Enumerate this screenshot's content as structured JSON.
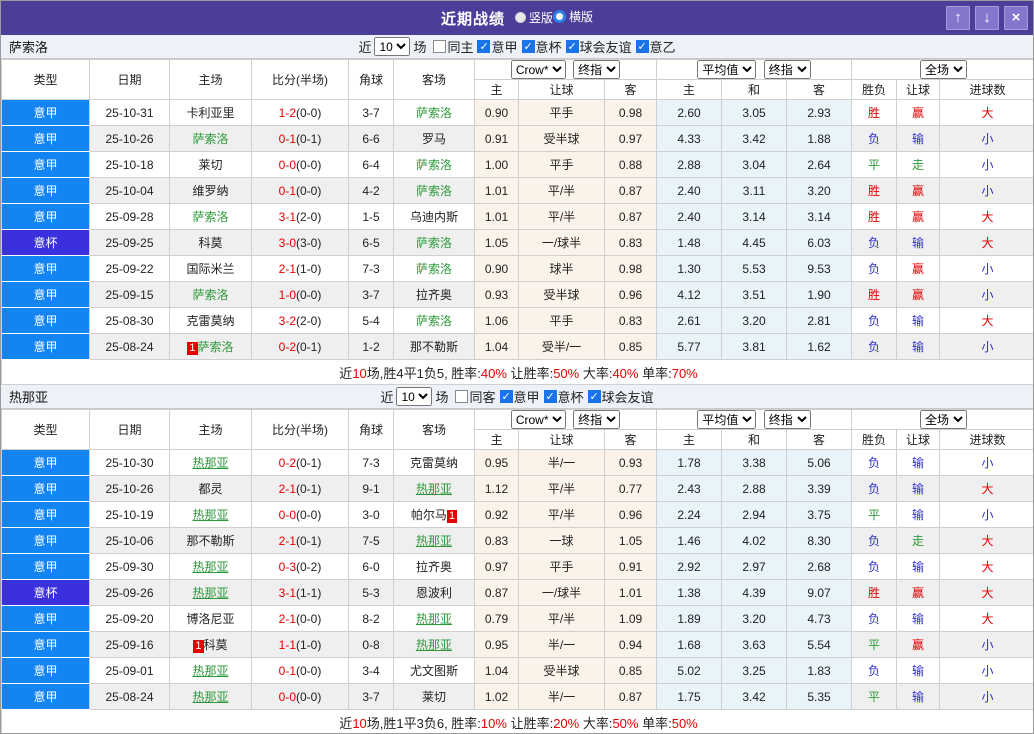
{
  "colors": {
    "titlebar_purple": "#4b3e99",
    "league_blue": "#1385f2",
    "cup_purple": "#3a30de",
    "focus_green": "#2c9a3a",
    "win_red": "#e60000",
    "loss_blue": "#2e2ed2",
    "draw_green": "#2c9a3a"
  },
  "titlebar": {
    "title": "近期战绩",
    "radios": [
      {
        "label": "竖版",
        "checked": false
      },
      {
        "label": "横版",
        "checked": true
      }
    ],
    "buttons": {
      "up": "↑",
      "down": "↓",
      "close": "×"
    }
  },
  "table_header": {
    "type": "类型",
    "date": "日期",
    "home": "主场",
    "score": "比分(半场)",
    "corner": "角球",
    "away": "客场",
    "odds_cols": [
      "主",
      "让球",
      "客"
    ],
    "avg_cols": [
      "主",
      "和",
      "客"
    ],
    "result_cols": [
      "胜负",
      "让球",
      "进球数"
    ]
  },
  "sections": [
    {
      "team": "萨索洛",
      "filter": {
        "near": "近",
        "count": "10",
        "games": "场",
        "same": {
          "label": "同主",
          "checked": false
        },
        "leagues": [
          {
            "label": "意甲",
            "checked": true
          },
          {
            "label": "意杯",
            "checked": true
          },
          {
            "label": "球会友谊",
            "checked": true
          },
          {
            "label": "意乙",
            "checked": true
          }
        ]
      },
      "selects": {
        "odds1": "Crow*",
        "odds2": "终指",
        "avg1": "平均值",
        "avg2": "终指",
        "scope": "全场"
      },
      "focus_underline": false,
      "rows": [
        {
          "type": "意甲",
          "cup": false,
          "date": "25-10-31",
          "home": {
            "name": "卡利亚里",
            "focus": false
          },
          "score_ft": "1-2",
          "score_ht": "(0-0)",
          "corner": "3-7",
          "away": {
            "name": "萨索洛",
            "focus": true
          },
          "odds": [
            "0.90",
            "平手",
            "0.98"
          ],
          "avg": [
            "2.60",
            "3.05",
            "2.93"
          ],
          "result": [
            [
              "胜",
              "r"
            ],
            [
              "赢",
              "r"
            ],
            [
              "大",
              "r"
            ]
          ]
        },
        {
          "type": "意甲",
          "cup": false,
          "date": "25-10-26",
          "home": {
            "name": "萨索洛",
            "focus": true
          },
          "score_ft": "0-1",
          "score_ht": "(0-1)",
          "corner": "6-6",
          "away": {
            "name": "罗马",
            "focus": false
          },
          "odds": [
            "0.91",
            "受半球",
            "0.97"
          ],
          "avg": [
            "4.33",
            "3.42",
            "1.88"
          ],
          "result": [
            [
              "负",
              "b"
            ],
            [
              "输",
              "b"
            ],
            [
              "小",
              "b"
            ]
          ]
        },
        {
          "type": "意甲",
          "cup": false,
          "date": "25-10-18",
          "home": {
            "name": "莱切",
            "focus": false
          },
          "score_ft": "0-0",
          "score_ht": "(0-0)",
          "corner": "6-4",
          "away": {
            "name": "萨索洛",
            "focus": true
          },
          "odds": [
            "1.00",
            "平手",
            "0.88"
          ],
          "avg": [
            "2.88",
            "3.04",
            "2.64"
          ],
          "result": [
            [
              "平",
              "g"
            ],
            [
              "走",
              "g"
            ],
            [
              "小",
              "b"
            ]
          ]
        },
        {
          "type": "意甲",
          "cup": false,
          "date": "25-10-04",
          "home": {
            "name": "维罗纳",
            "focus": false
          },
          "score_ft": "0-1",
          "score_ht": "(0-0)",
          "corner": "4-2",
          "away": {
            "name": "萨索洛",
            "focus": true
          },
          "odds": [
            "1.01",
            "平/半",
            "0.87"
          ],
          "avg": [
            "2.40",
            "3.11",
            "3.20"
          ],
          "result": [
            [
              "胜",
              "r"
            ],
            [
              "赢",
              "r"
            ],
            [
              "小",
              "b"
            ]
          ]
        },
        {
          "type": "意甲",
          "cup": false,
          "date": "25-09-28",
          "home": {
            "name": "萨索洛",
            "focus": true
          },
          "score_ft": "3-1",
          "score_ht": "(2-0)",
          "corner": "1-5",
          "away": {
            "name": "乌迪内斯",
            "focus": false
          },
          "odds": [
            "1.01",
            "平/半",
            "0.87"
          ],
          "avg": [
            "2.40",
            "3.14",
            "3.14"
          ],
          "result": [
            [
              "胜",
              "r"
            ],
            [
              "赢",
              "r"
            ],
            [
              "大",
              "r"
            ]
          ]
        },
        {
          "type": "意杯",
          "cup": true,
          "date": "25-09-25",
          "home": {
            "name": "科莫",
            "focus": false
          },
          "score_ft": "3-0",
          "score_ht": "(3-0)",
          "corner": "6-5",
          "away": {
            "name": "萨索洛",
            "focus": true
          },
          "odds": [
            "1.05",
            "一/球半",
            "0.83"
          ],
          "avg": [
            "1.48",
            "4.45",
            "6.03"
          ],
          "result": [
            [
              "负",
              "b"
            ],
            [
              "输",
              "b"
            ],
            [
              "大",
              "r"
            ]
          ]
        },
        {
          "type": "意甲",
          "cup": false,
          "date": "25-09-22",
          "home": {
            "name": "国际米兰",
            "focus": false
          },
          "score_ft": "2-1",
          "score_ht": "(1-0)",
          "corner": "7-3",
          "away": {
            "name": "萨索洛",
            "focus": true
          },
          "odds": [
            "0.90",
            "球半",
            "0.98"
          ],
          "avg": [
            "1.30",
            "5.53",
            "9.53"
          ],
          "result": [
            [
              "负",
              "b"
            ],
            [
              "赢",
              "r"
            ],
            [
              "小",
              "b"
            ]
          ]
        },
        {
          "type": "意甲",
          "cup": false,
          "date": "25-09-15",
          "home": {
            "name": "萨索洛",
            "focus": true
          },
          "score_ft": "1-0",
          "score_ht": "(0-0)",
          "corner": "3-7",
          "away": {
            "name": "拉齐奥",
            "focus": false
          },
          "odds": [
            "0.93",
            "受半球",
            "0.96"
          ],
          "avg": [
            "4.12",
            "3.51",
            "1.90"
          ],
          "result": [
            [
              "胜",
              "r"
            ],
            [
              "赢",
              "r"
            ],
            [
              "小",
              "b"
            ]
          ]
        },
        {
          "type": "意甲",
          "cup": false,
          "date": "25-08-30",
          "home": {
            "name": "克雷莫纳",
            "focus": false
          },
          "score_ft": "3-2",
          "score_ht": "(2-0)",
          "corner": "5-4",
          "away": {
            "name": "萨索洛",
            "focus": true
          },
          "odds": [
            "1.06",
            "平手",
            "0.83"
          ],
          "avg": [
            "2.61",
            "3.20",
            "2.81"
          ],
          "result": [
            [
              "负",
              "b"
            ],
            [
              "输",
              "b"
            ],
            [
              "大",
              "r"
            ]
          ]
        },
        {
          "type": "意甲",
          "cup": false,
          "date": "25-08-24",
          "home": {
            "name": "萨索洛",
            "focus": true,
            "badge": "1",
            "badge_side": "left"
          },
          "score_ft": "0-2",
          "score_ht": "(0-1)",
          "corner": "1-2",
          "away": {
            "name": "那不勒斯",
            "focus": false
          },
          "odds": [
            "1.04",
            "受半/一",
            "0.85"
          ],
          "avg": [
            "5.77",
            "3.81",
            "1.62"
          ],
          "result": [
            [
              "负",
              "b"
            ],
            [
              "输",
              "b"
            ],
            [
              "小",
              "b"
            ]
          ]
        }
      ],
      "summary": [
        {
          "t": "近"
        },
        {
          "t": "10",
          "red": true
        },
        {
          "t": "场,胜4平1负5, 胜率:"
        },
        {
          "t": "40%",
          "red": true
        },
        {
          "t": " 让胜率:"
        },
        {
          "t": "50%",
          "red": true
        },
        {
          "t": " 大率:"
        },
        {
          "t": "40%",
          "red": true
        },
        {
          "t": " 单率:"
        },
        {
          "t": "70%",
          "red": true
        }
      ]
    },
    {
      "team": "热那亚",
      "filter": {
        "near": "近",
        "count": "10",
        "games": "场",
        "same": {
          "label": "同客",
          "checked": false
        },
        "leagues": [
          {
            "label": "意甲",
            "checked": true
          },
          {
            "label": "意杯",
            "checked": true
          },
          {
            "label": "球会友谊",
            "checked": true
          }
        ]
      },
      "selects": {
        "odds1": "Crow*",
        "odds2": "终指",
        "avg1": "平均值",
        "avg2": "终指",
        "scope": "全场"
      },
      "focus_underline": true,
      "rows": [
        {
          "type": "意甲",
          "cup": false,
          "date": "25-10-30",
          "home": {
            "name": "热那亚",
            "focus": true
          },
          "score_ft": "0-2",
          "score_ht": "(0-1)",
          "corner": "7-3",
          "away": {
            "name": "克雷莫纳",
            "focus": false
          },
          "odds": [
            "0.95",
            "半/一",
            "0.93"
          ],
          "avg": [
            "1.78",
            "3.38",
            "5.06"
          ],
          "result": [
            [
              "负",
              "b"
            ],
            [
              "输",
              "b"
            ],
            [
              "小",
              "b"
            ]
          ]
        },
        {
          "type": "意甲",
          "cup": false,
          "date": "25-10-26",
          "home": {
            "name": "都灵",
            "focus": false
          },
          "score_ft": "2-1",
          "score_ht": "(0-1)",
          "corner": "9-1",
          "away": {
            "name": "热那亚",
            "focus": true
          },
          "odds": [
            "1.12",
            "平/半",
            "0.77"
          ],
          "avg": [
            "2.43",
            "2.88",
            "3.39"
          ],
          "result": [
            [
              "负",
              "b"
            ],
            [
              "输",
              "b"
            ],
            [
              "大",
              "r"
            ]
          ]
        },
        {
          "type": "意甲",
          "cup": false,
          "date": "25-10-19",
          "home": {
            "name": "热那亚",
            "focus": true
          },
          "score_ft": "0-0",
          "score_ht": "(0-0)",
          "corner": "3-0",
          "away": {
            "name": "帕尔马",
            "focus": false,
            "badge": "1",
            "badge_side": "right"
          },
          "odds": [
            "0.92",
            "平/半",
            "0.96"
          ],
          "avg": [
            "2.24",
            "2.94",
            "3.75"
          ],
          "result": [
            [
              "平",
              "g"
            ],
            [
              "输",
              "b"
            ],
            [
              "小",
              "b"
            ]
          ]
        },
        {
          "type": "意甲",
          "cup": false,
          "date": "25-10-06",
          "home": {
            "name": "那不勒斯",
            "focus": false
          },
          "score_ft": "2-1",
          "score_ht": "(0-1)",
          "corner": "7-5",
          "away": {
            "name": "热那亚",
            "focus": true
          },
          "odds": [
            "0.83",
            "一球",
            "1.05"
          ],
          "avg": [
            "1.46",
            "4.02",
            "8.30"
          ],
          "result": [
            [
              "负",
              "b"
            ],
            [
              "走",
              "g"
            ],
            [
              "大",
              "r"
            ]
          ]
        },
        {
          "type": "意甲",
          "cup": false,
          "date": "25-09-30",
          "home": {
            "name": "热那亚",
            "focus": true
          },
          "score_ft": "0-3",
          "score_ht": "(0-2)",
          "corner": "6-0",
          "away": {
            "name": "拉齐奥",
            "focus": false
          },
          "odds": [
            "0.97",
            "平手",
            "0.91"
          ],
          "avg": [
            "2.92",
            "2.97",
            "2.68"
          ],
          "result": [
            [
              "负",
              "b"
            ],
            [
              "输",
              "b"
            ],
            [
              "大",
              "r"
            ]
          ]
        },
        {
          "type": "意杯",
          "cup": true,
          "date": "25-09-26",
          "home": {
            "name": "热那亚",
            "focus": true
          },
          "score_ft": "3-1",
          "score_ht": "(1-1)",
          "corner": "5-3",
          "away": {
            "name": "恩波利",
            "focus": false
          },
          "odds": [
            "0.87",
            "一/球半",
            "1.01"
          ],
          "avg": [
            "1.38",
            "4.39",
            "9.07"
          ],
          "result": [
            [
              "胜",
              "r"
            ],
            [
              "赢",
              "r"
            ],
            [
              "大",
              "r"
            ]
          ]
        },
        {
          "type": "意甲",
          "cup": false,
          "date": "25-09-20",
          "home": {
            "name": "博洛尼亚",
            "focus": false
          },
          "score_ft": "2-1",
          "score_ht": "(0-0)",
          "corner": "8-2",
          "away": {
            "name": "热那亚",
            "focus": true
          },
          "odds": [
            "0.79",
            "平/半",
            "1.09"
          ],
          "avg": [
            "1.89",
            "3.20",
            "4.73"
          ],
          "result": [
            [
              "负",
              "b"
            ],
            [
              "输",
              "b"
            ],
            [
              "大",
              "r"
            ]
          ]
        },
        {
          "type": "意甲",
          "cup": false,
          "date": "25-09-16",
          "home": {
            "name": "科莫",
            "focus": false,
            "badge": "1",
            "badge_side": "left"
          },
          "score_ft": "1-1",
          "score_ht": "(1-0)",
          "corner": "0-8",
          "away": {
            "name": "热那亚",
            "focus": true
          },
          "odds": [
            "0.95",
            "半/一",
            "0.94"
          ],
          "avg": [
            "1.68",
            "3.63",
            "5.54"
          ],
          "result": [
            [
              "平",
              "g"
            ],
            [
              "赢",
              "r"
            ],
            [
              "小",
              "b"
            ]
          ]
        },
        {
          "type": "意甲",
          "cup": false,
          "date": "25-09-01",
          "home": {
            "name": "热那亚",
            "focus": true
          },
          "score_ft": "0-1",
          "score_ht": "(0-0)",
          "corner": "3-4",
          "away": {
            "name": "尤文图斯",
            "focus": false
          },
          "odds": [
            "1.04",
            "受半球",
            "0.85"
          ],
          "avg": [
            "5.02",
            "3.25",
            "1.83"
          ],
          "result": [
            [
              "负",
              "b"
            ],
            [
              "输",
              "b"
            ],
            [
              "小",
              "b"
            ]
          ]
        },
        {
          "type": "意甲",
          "cup": false,
          "date": "25-08-24",
          "home": {
            "name": "热那亚",
            "focus": true
          },
          "score_ft": "0-0",
          "score_ht": "(0-0)",
          "corner": "3-7",
          "away": {
            "name": "莱切",
            "focus": false
          },
          "odds": [
            "1.02",
            "半/一",
            "0.87"
          ],
          "avg": [
            "1.75",
            "3.42",
            "5.35"
          ],
          "result": [
            [
              "平",
              "g"
            ],
            [
              "输",
              "b"
            ],
            [
              "小",
              "b"
            ]
          ]
        }
      ],
      "summary": [
        {
          "t": "近"
        },
        {
          "t": "10",
          "red": true
        },
        {
          "t": "场,胜1平3负6, 胜率:"
        },
        {
          "t": "10%",
          "red": true
        },
        {
          "t": " 让胜率:"
        },
        {
          "t": "20%",
          "red": true
        },
        {
          "t": " 大率:"
        },
        {
          "t": "50%",
          "red": true
        },
        {
          "t": " 单率:"
        },
        {
          "t": "50%",
          "red": true
        }
      ]
    }
  ]
}
